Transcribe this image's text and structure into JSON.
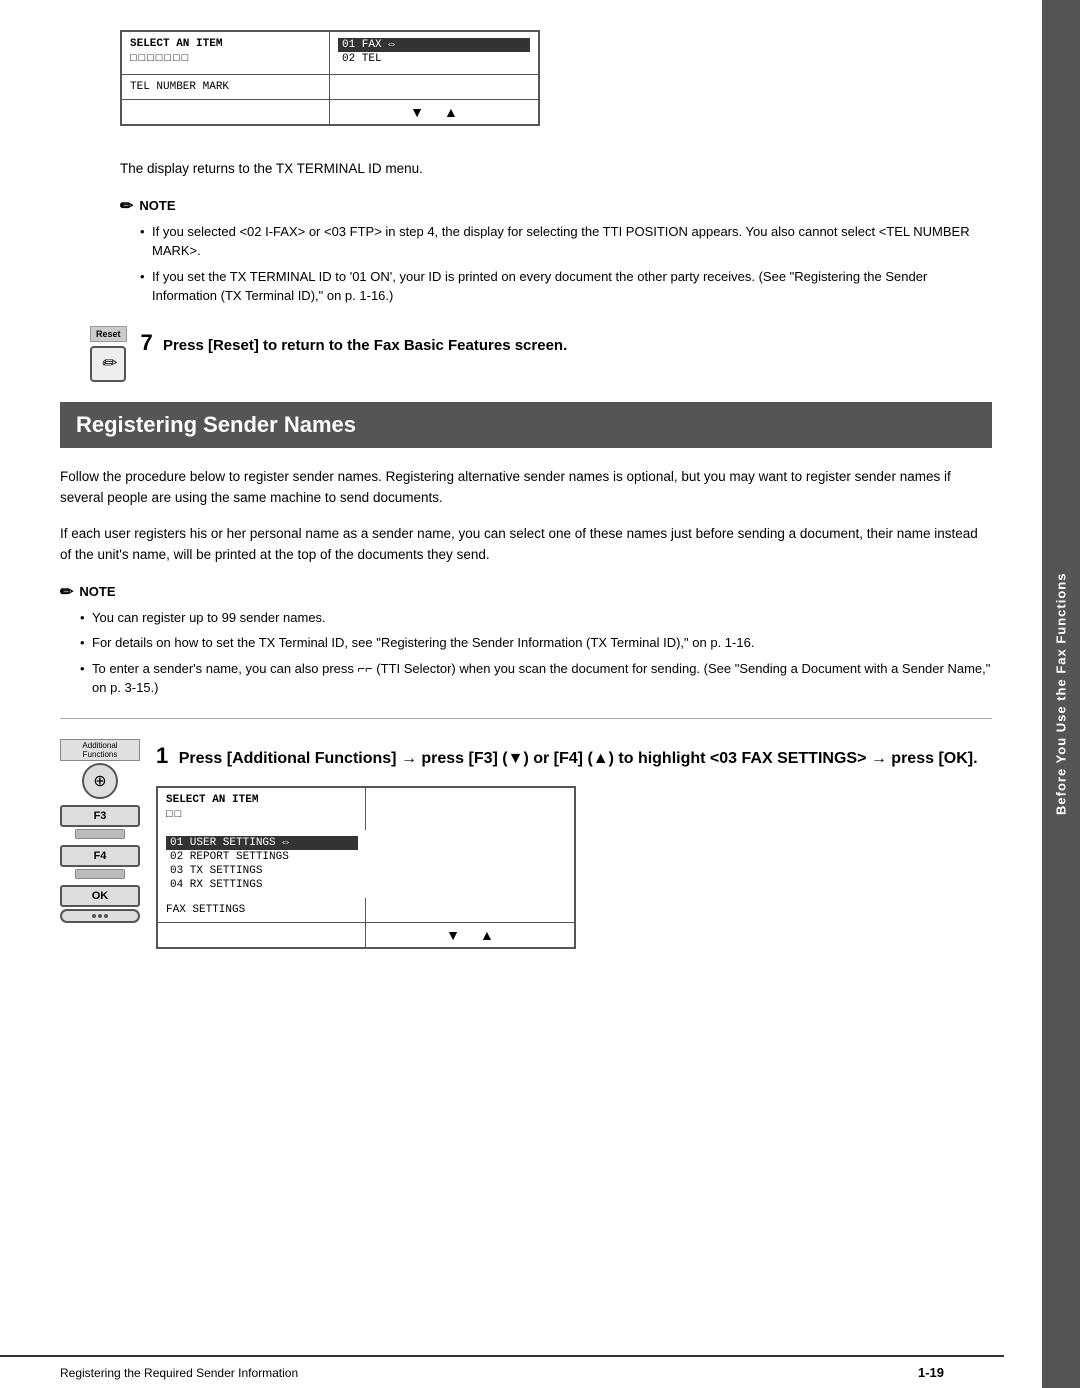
{
  "side_tab": {
    "label": "Before You Use the Fax Functions"
  },
  "screen1": {
    "left_header": "SELECT AN ITEM",
    "dots": "□□□□□□□",
    "bottom_left": "TEL NUMBER MARK",
    "right_items": [
      {
        "id": "01",
        "label": "FAX",
        "selected": true
      },
      {
        "id": "02",
        "label": "TEL"
      }
    ],
    "nav_down": "▼",
    "nav_up": "▲"
  },
  "display_returns_text": "The display returns to the TX TERMINAL ID menu.",
  "note1": {
    "header": "NOTE",
    "items": [
      "If you selected <02 I-FAX> or <03 FTP> in step 4, the display for selecting the TTI POSITION appears. You also cannot select <TEL NUMBER MARK>.",
      "If you set the TX TERMINAL ID to '01 ON', your ID is printed on every document the other party receives. (See \"Registering the Sender Information (TX Terminal ID),\" on p. 1-16.)"
    ]
  },
  "step7": {
    "number": "7",
    "reset_label": "Reset",
    "reset_icon": "✏",
    "text": "Press [Reset] to return to the Fax Basic Features screen."
  },
  "section_heading": "Registering Sender Names",
  "body_para1": "Follow the procedure below to register sender names. Registering alternative sender names is optional, but you may want to register sender names if several people are using the same machine to send documents.",
  "body_para2": "If each user registers his or her personal name as a sender name, you can select one of these names just before sending a document, their name instead of the unit's name, will be printed at the top of the documents they send.",
  "note2": {
    "header": "NOTE",
    "items": [
      "You can register up to 99 sender names.",
      "For details on how to set the TX Terminal ID, see \"Registering the Sender Information (TX Terminal ID),\" on p. 1-16.",
      "To enter a sender's name, you can also press ⌐⌐ (TTI Selector) when you scan the document for sending. (See \"Sending a Document with a Sender Name,\" on p. 3-15.)"
    ]
  },
  "step1": {
    "number": "1",
    "buttons": {
      "additional_functions_label": "Additional Functions",
      "additional_icon": "⊕",
      "f3_label": "F3",
      "f4_label": "F4",
      "ok_label": "OK"
    },
    "text": "Press [Additional Functions] → press [F3] (▼) or [F4] (▲) to highlight <03 FAX SETTINGS> → press [OK]."
  },
  "screen2": {
    "left_header": "SELECT AN ITEM",
    "dots": "□□",
    "bottom_left": "FAX SETTINGS",
    "right_items": [
      {
        "id": "01",
        "label": "USER SETTINGS",
        "selected": true
      },
      {
        "id": "02",
        "label": "REPORT SETTINGS"
      },
      {
        "id": "03",
        "label": "TX SETTINGS"
      },
      {
        "id": "04",
        "label": "RX SETTINGS"
      }
    ],
    "nav_down": "▼",
    "nav_up": "▲"
  },
  "footer": {
    "left_text": "Registering the Required Sender Information",
    "page_number": "1-19"
  }
}
